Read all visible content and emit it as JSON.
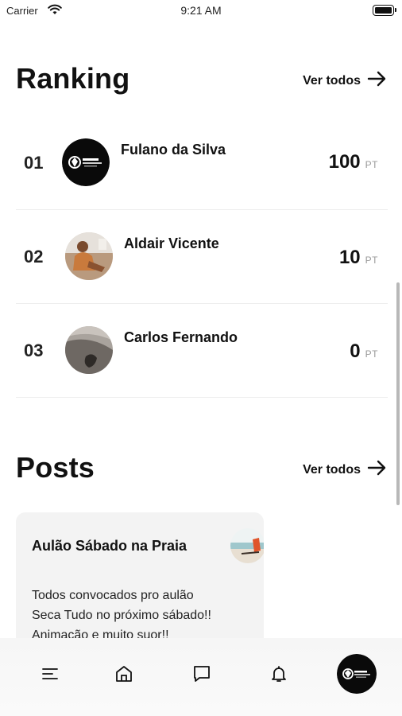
{
  "status_bar": {
    "carrier": "Carrier",
    "time": "9:21 AM"
  },
  "ranking": {
    "title": "Ranking",
    "see_all": "Ver todos",
    "entries": [
      {
        "position": "01",
        "name": "Fulano da Silva",
        "score": "100",
        "unit": "PT",
        "avatar": "tribe-logo-avatar"
      },
      {
        "position": "02",
        "name": "Aldair Vicente",
        "score": "10",
        "unit": "PT",
        "avatar": "beach-photo-avatar"
      },
      {
        "position": "03",
        "name": "Carlos Fernando",
        "score": "0",
        "unit": "PT",
        "avatar": "shadow-photo-avatar"
      }
    ]
  },
  "posts": {
    "title": "Posts",
    "see_all": "Ver todos",
    "items": [
      {
        "title": "Aulão Sábado na Praia",
        "body": "Todos convocados pro aulão\nSeca Tudo no próximo sábado!!\nAnimação e muito suor!!"
      }
    ]
  },
  "tab_bar": {
    "items": [
      "menu-icon",
      "home-icon",
      "chat-icon",
      "bell-icon",
      "profile-avatar"
    ]
  },
  "colors": {
    "text": "#111111",
    "muted": "#9a9a9a",
    "card_bg": "#f3f3f3",
    "divider": "#eeeeee"
  }
}
